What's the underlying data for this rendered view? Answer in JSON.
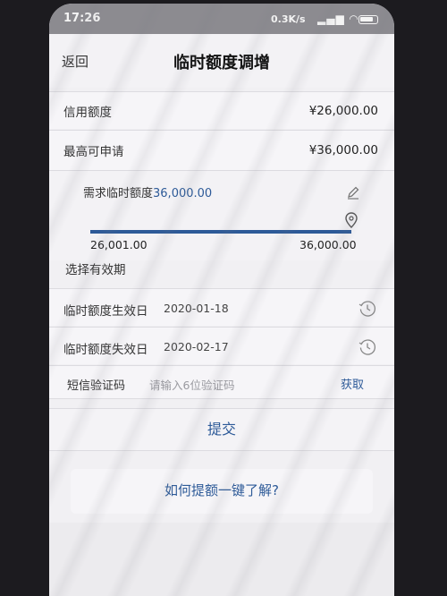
{
  "status_bar": {
    "time": "17:26",
    "network_speed": "0.3K/s"
  },
  "header": {
    "back_label": "返回",
    "title": "临时额度调增"
  },
  "credit": {
    "limit_label": "信用额度",
    "limit_value": "¥26,000.00",
    "max_label": "最高可申请",
    "max_value": "¥36,000.00"
  },
  "request": {
    "label": "需求临时额度",
    "value": "36,000.00",
    "slider_min": "26,001.00",
    "slider_max": "36,000.00",
    "slider_fraction": 1.0
  },
  "validity": {
    "section_title": "选择有效期",
    "start_label": "临时额度生效日",
    "start_date": "2020-01-18",
    "end_label": "临时额度失效日",
    "end_date": "2020-02-17"
  },
  "sms": {
    "label": "短信验证码",
    "placeholder": "请输入6位验证码",
    "get_code_label": "获取"
  },
  "actions": {
    "submit_label": "提交",
    "help_label": "如何提额一键了解?"
  },
  "colors": {
    "accent": "#2d5a98"
  }
}
